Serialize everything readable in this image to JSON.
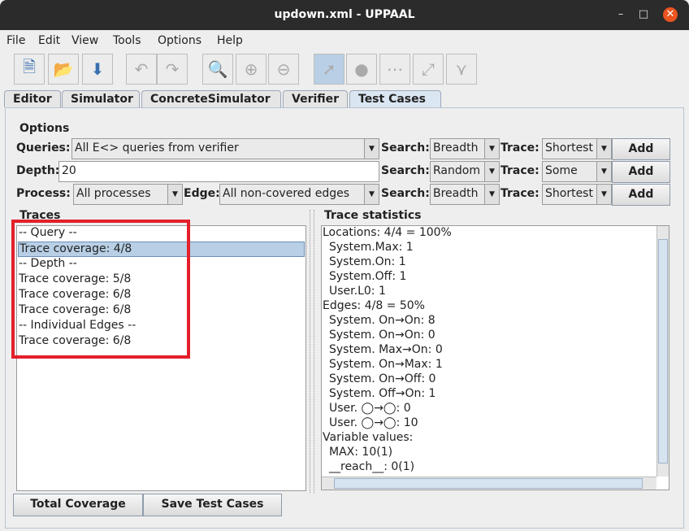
{
  "window": {
    "title": "updown.xml - UPPAAL"
  },
  "menu": [
    "File",
    "Edit",
    "View",
    "Tools",
    "Options",
    "Help"
  ],
  "toolbar": [
    "new-icon",
    "open-icon",
    "save-icon",
    "undo-icon",
    "redo-icon",
    "zoom-fit-icon",
    "zoom-in-icon",
    "zoom-out-icon",
    "select-icon",
    "location-icon",
    "nail-icon",
    "edge-icon",
    "branch-icon"
  ],
  "tabs": [
    "Editor",
    "Simulator",
    "ConcreteSimulator",
    "Verifier",
    "Test Cases"
  ],
  "active_tab": "Test Cases",
  "options": {
    "heading": "Options",
    "queries_label": "Queries:",
    "queries_value": "All E<> queries from verifier",
    "depth_label": "Depth:",
    "depth_value": "20",
    "process_label": "Process:",
    "process_value": "All processes",
    "edge_label": "Edge:",
    "edge_value": "All non-covered edges",
    "search_label": "Search:",
    "trace_label": "Trace:",
    "add_label": "Add",
    "rows": [
      {
        "search": "Breadth",
        "trace": "Shortest"
      },
      {
        "search": "Random",
        "trace": "Some"
      },
      {
        "search": "Breadth",
        "trace": "Shortest"
      }
    ]
  },
  "traces": {
    "heading": "Traces",
    "items": [
      "-- Query --",
      "Trace coverage: 4/8",
      "-- Depth --",
      "Trace coverage: 5/8",
      "Trace coverage: 6/8",
      "Trace coverage: 6/8",
      "-- Individual Edges --",
      "Trace coverage: 6/8"
    ],
    "selected_index": 1
  },
  "stats": {
    "heading": "Trace statistics",
    "lines": [
      "Locations: 4/4 = 100%",
      " System.Max: 1",
      " System.On: 1",
      " System.Off: 1",
      " User.L0: 1",
      "Edges: 4/8 = 50%",
      " System. On→On: 8",
      " System. On→On: 0",
      " System. Max→On: 0",
      " System. On→Max: 1",
      " System. On→Off: 0",
      " System. Off→On: 1",
      " User. ◯→◯: 0",
      " User. ◯→◯: 10",
      "Variable values:",
      " MAX: 10(1)",
      " __reach__: 0(1)"
    ]
  },
  "buttons": {
    "total_coverage": "Total Coverage",
    "save_test_cases": "Save Test Cases"
  },
  "highlight_color": "#e3202a"
}
